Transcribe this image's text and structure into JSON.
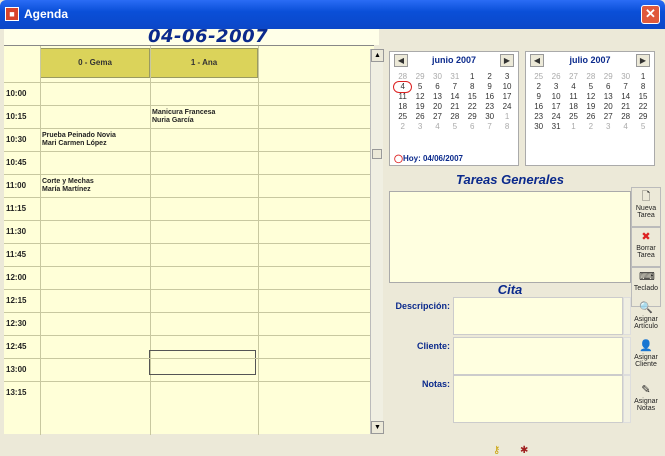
{
  "window": {
    "title": "Agenda"
  },
  "header": {
    "date": "04-06-2007"
  },
  "columns": [
    "0 - Gema",
    "1 - Ana"
  ],
  "times": [
    "10:00",
    "10:15",
    "10:30",
    "10:45",
    "11:00",
    "11:15",
    "11:30",
    "11:45",
    "12:00",
    "12:15",
    "12:30",
    "12:45",
    "13:00",
    "13:15"
  ],
  "appointments": [
    {
      "col": 1,
      "line1": "Manicura Francesa",
      "line2": "Nuria García"
    },
    {
      "col": 0,
      "line1": "Prueba Peinado Novia",
      "line2": "Mari Carmen López"
    },
    {
      "col": 0,
      "line1": "Corte y Mechas",
      "line2": "María Martínez"
    }
  ],
  "calendar_june": {
    "title": "junio 2007",
    "weeks": [
      [
        "28",
        "29",
        "30",
        "31",
        "1",
        "2",
        "3"
      ],
      [
        "4",
        "5",
        "6",
        "7",
        "8",
        "9",
        "10"
      ],
      [
        "11",
        "12",
        "13",
        "14",
        "15",
        "16",
        "17"
      ],
      [
        "18",
        "19",
        "20",
        "21",
        "22",
        "23",
        "24"
      ],
      [
        "25",
        "26",
        "27",
        "28",
        "29",
        "30",
        "1"
      ],
      [
        "2",
        "3",
        "4",
        "5",
        "6",
        "7",
        "8"
      ]
    ],
    "today_label": "Hoy: 04/06/2007"
  },
  "calendar_july": {
    "title": "julio 2007",
    "weeks": [
      [
        "25",
        "26",
        "27",
        "28",
        "29",
        "30",
        "1"
      ],
      [
        "2",
        "3",
        "4",
        "5",
        "6",
        "7",
        "8"
      ],
      [
        "9",
        "10",
        "11",
        "12",
        "13",
        "14",
        "15"
      ],
      [
        "16",
        "17",
        "18",
        "19",
        "20",
        "21",
        "22"
      ],
      [
        "23",
        "24",
        "25",
        "26",
        "27",
        "28",
        "29"
      ],
      [
        "30",
        "31",
        "1",
        "2",
        "3",
        "4",
        "5"
      ]
    ]
  },
  "tareas": {
    "title": "Tareas Generales",
    "nueva": "Nueva Tarea",
    "borrar": "Borrar Tarea",
    "teclado": "Teclado"
  },
  "cita": {
    "title": "Cita",
    "descripcion": "Descripción:",
    "cliente": "Cliente:",
    "notas": "Notas:",
    "asignar_articulo": "Asignar Artículo",
    "asignar_cliente": "Asignar Cliente",
    "asignar_notas": "Asignar Notas"
  }
}
